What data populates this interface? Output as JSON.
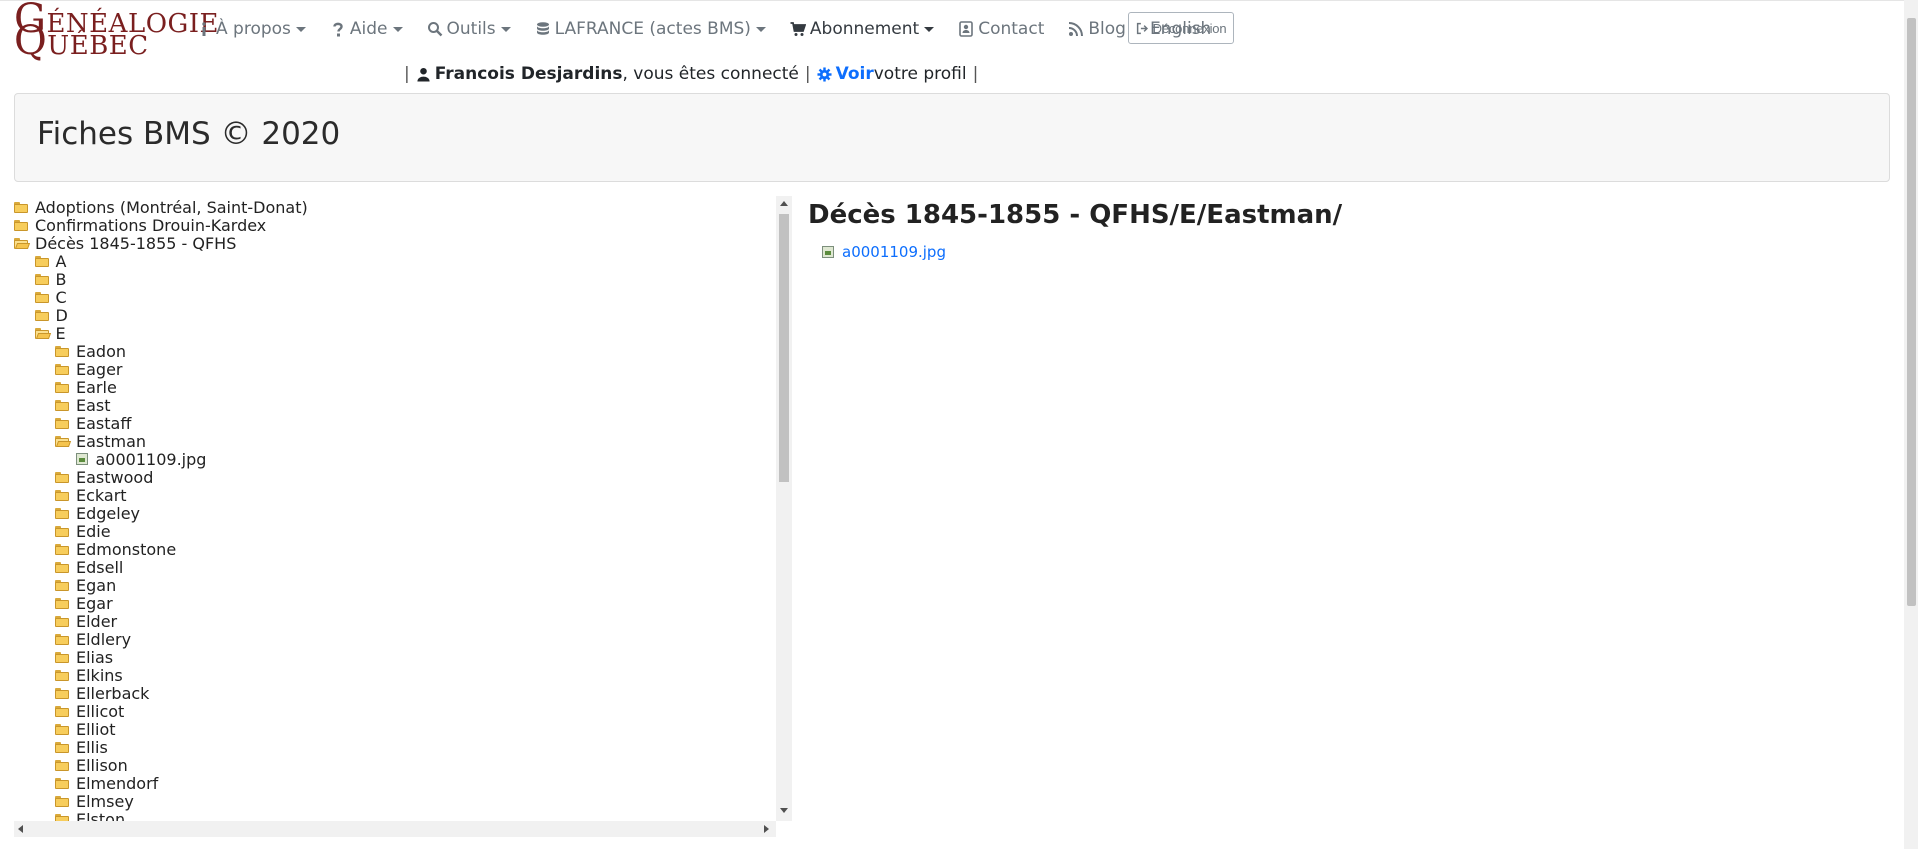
{
  "logo": {
    "line1_big": "G",
    "line1_rest": "ÉNÉALOGIE",
    "line2_big": "Q",
    "line2_rest": "UÉBEC"
  },
  "nav": {
    "items": [
      {
        "label": "À propos",
        "icon": "info-icon",
        "dropdown": true
      },
      {
        "label": "Aide",
        "icon": "question-icon",
        "dropdown": true
      },
      {
        "label": "Outils",
        "icon": "search-icon",
        "dropdown": true
      },
      {
        "label": "LAFRANCE (actes BMS)",
        "icon": "database-icon",
        "dropdown": true
      },
      {
        "label": "Abonnement",
        "icon": "cart-icon",
        "dropdown": true
      },
      {
        "label": "Contact",
        "icon": "contact-card-icon",
        "dropdown": false
      },
      {
        "label": "Blog",
        "icon": "rss-icon",
        "dropdown": false
      },
      {
        "label": "English",
        "icon": "",
        "dropdown": false
      }
    ],
    "logout_label": "Déconnexion"
  },
  "userbar": {
    "sep": "|",
    "user_name": "Francois Desjardins",
    "connected_text": ", vous êtes connecté",
    "voir_label": "Voir",
    "profile_text": " votre profil"
  },
  "jumbo": {
    "title": "Fiches BMS © 2020"
  },
  "tree": {
    "nodes": [
      {
        "label": "Adoptions (Montréal, Saint-Donat)",
        "level": 0,
        "type": "folder",
        "open": false
      },
      {
        "label": "Confirmations Drouin-Kardex",
        "level": 0,
        "type": "folder",
        "open": false
      },
      {
        "label": "Décès 1845-1855 - QFHS",
        "level": 0,
        "type": "folder",
        "open": true
      },
      {
        "label": "A",
        "level": 1,
        "type": "folder",
        "open": false
      },
      {
        "label": "B",
        "level": 1,
        "type": "folder",
        "open": false
      },
      {
        "label": "C",
        "level": 1,
        "type": "folder",
        "open": false
      },
      {
        "label": "D",
        "level": 1,
        "type": "folder",
        "open": false
      },
      {
        "label": "E",
        "level": 1,
        "type": "folder",
        "open": true
      },
      {
        "label": "Eadon",
        "level": 2,
        "type": "folder",
        "open": false
      },
      {
        "label": "Eager",
        "level": 2,
        "type": "folder",
        "open": false
      },
      {
        "label": "Earle",
        "level": 2,
        "type": "folder",
        "open": false
      },
      {
        "label": "East",
        "level": 2,
        "type": "folder",
        "open": false
      },
      {
        "label": "Eastaff",
        "level": 2,
        "type": "folder",
        "open": false
      },
      {
        "label": "Eastman",
        "level": 2,
        "type": "folder",
        "open": true
      },
      {
        "label": "a0001109.jpg",
        "level": 3,
        "type": "file",
        "open": false
      },
      {
        "label": "Eastwood",
        "level": 2,
        "type": "folder",
        "open": false
      },
      {
        "label": "Eckart",
        "level": 2,
        "type": "folder",
        "open": false
      },
      {
        "label": "Edgeley",
        "level": 2,
        "type": "folder",
        "open": false
      },
      {
        "label": "Edie",
        "level": 2,
        "type": "folder",
        "open": false
      },
      {
        "label": "Edmonstone",
        "level": 2,
        "type": "folder",
        "open": false
      },
      {
        "label": "Edsell",
        "level": 2,
        "type": "folder",
        "open": false
      },
      {
        "label": "Egan",
        "level": 2,
        "type": "folder",
        "open": false
      },
      {
        "label": "Egar",
        "level": 2,
        "type": "folder",
        "open": false
      },
      {
        "label": "Elder",
        "level": 2,
        "type": "folder",
        "open": false
      },
      {
        "label": "Eldlery",
        "level": 2,
        "type": "folder",
        "open": false
      },
      {
        "label": "Elias",
        "level": 2,
        "type": "folder",
        "open": false
      },
      {
        "label": "Elkins",
        "level": 2,
        "type": "folder",
        "open": false
      },
      {
        "label": "Ellerback",
        "level": 2,
        "type": "folder",
        "open": false
      },
      {
        "label": "Ellicot",
        "level": 2,
        "type": "folder",
        "open": false
      },
      {
        "label": "Elliot",
        "level": 2,
        "type": "folder",
        "open": false
      },
      {
        "label": "Ellis",
        "level": 2,
        "type": "folder",
        "open": false
      },
      {
        "label": "Ellison",
        "level": 2,
        "type": "folder",
        "open": false
      },
      {
        "label": "Elmendorf",
        "level": 2,
        "type": "folder",
        "open": false
      },
      {
        "label": "Elmsey",
        "level": 2,
        "type": "folder",
        "open": false
      },
      {
        "label": "Elston",
        "level": 2,
        "type": "folder",
        "open": false
      }
    ]
  },
  "content": {
    "heading": "Décès 1845-1855 - QFHS/E/Eastman/",
    "files": [
      {
        "label": "a0001109.jpg"
      }
    ]
  },
  "colors": {
    "link": "#0d6efd",
    "logo": "#7a1f1f",
    "muted": "#6c757d"
  }
}
